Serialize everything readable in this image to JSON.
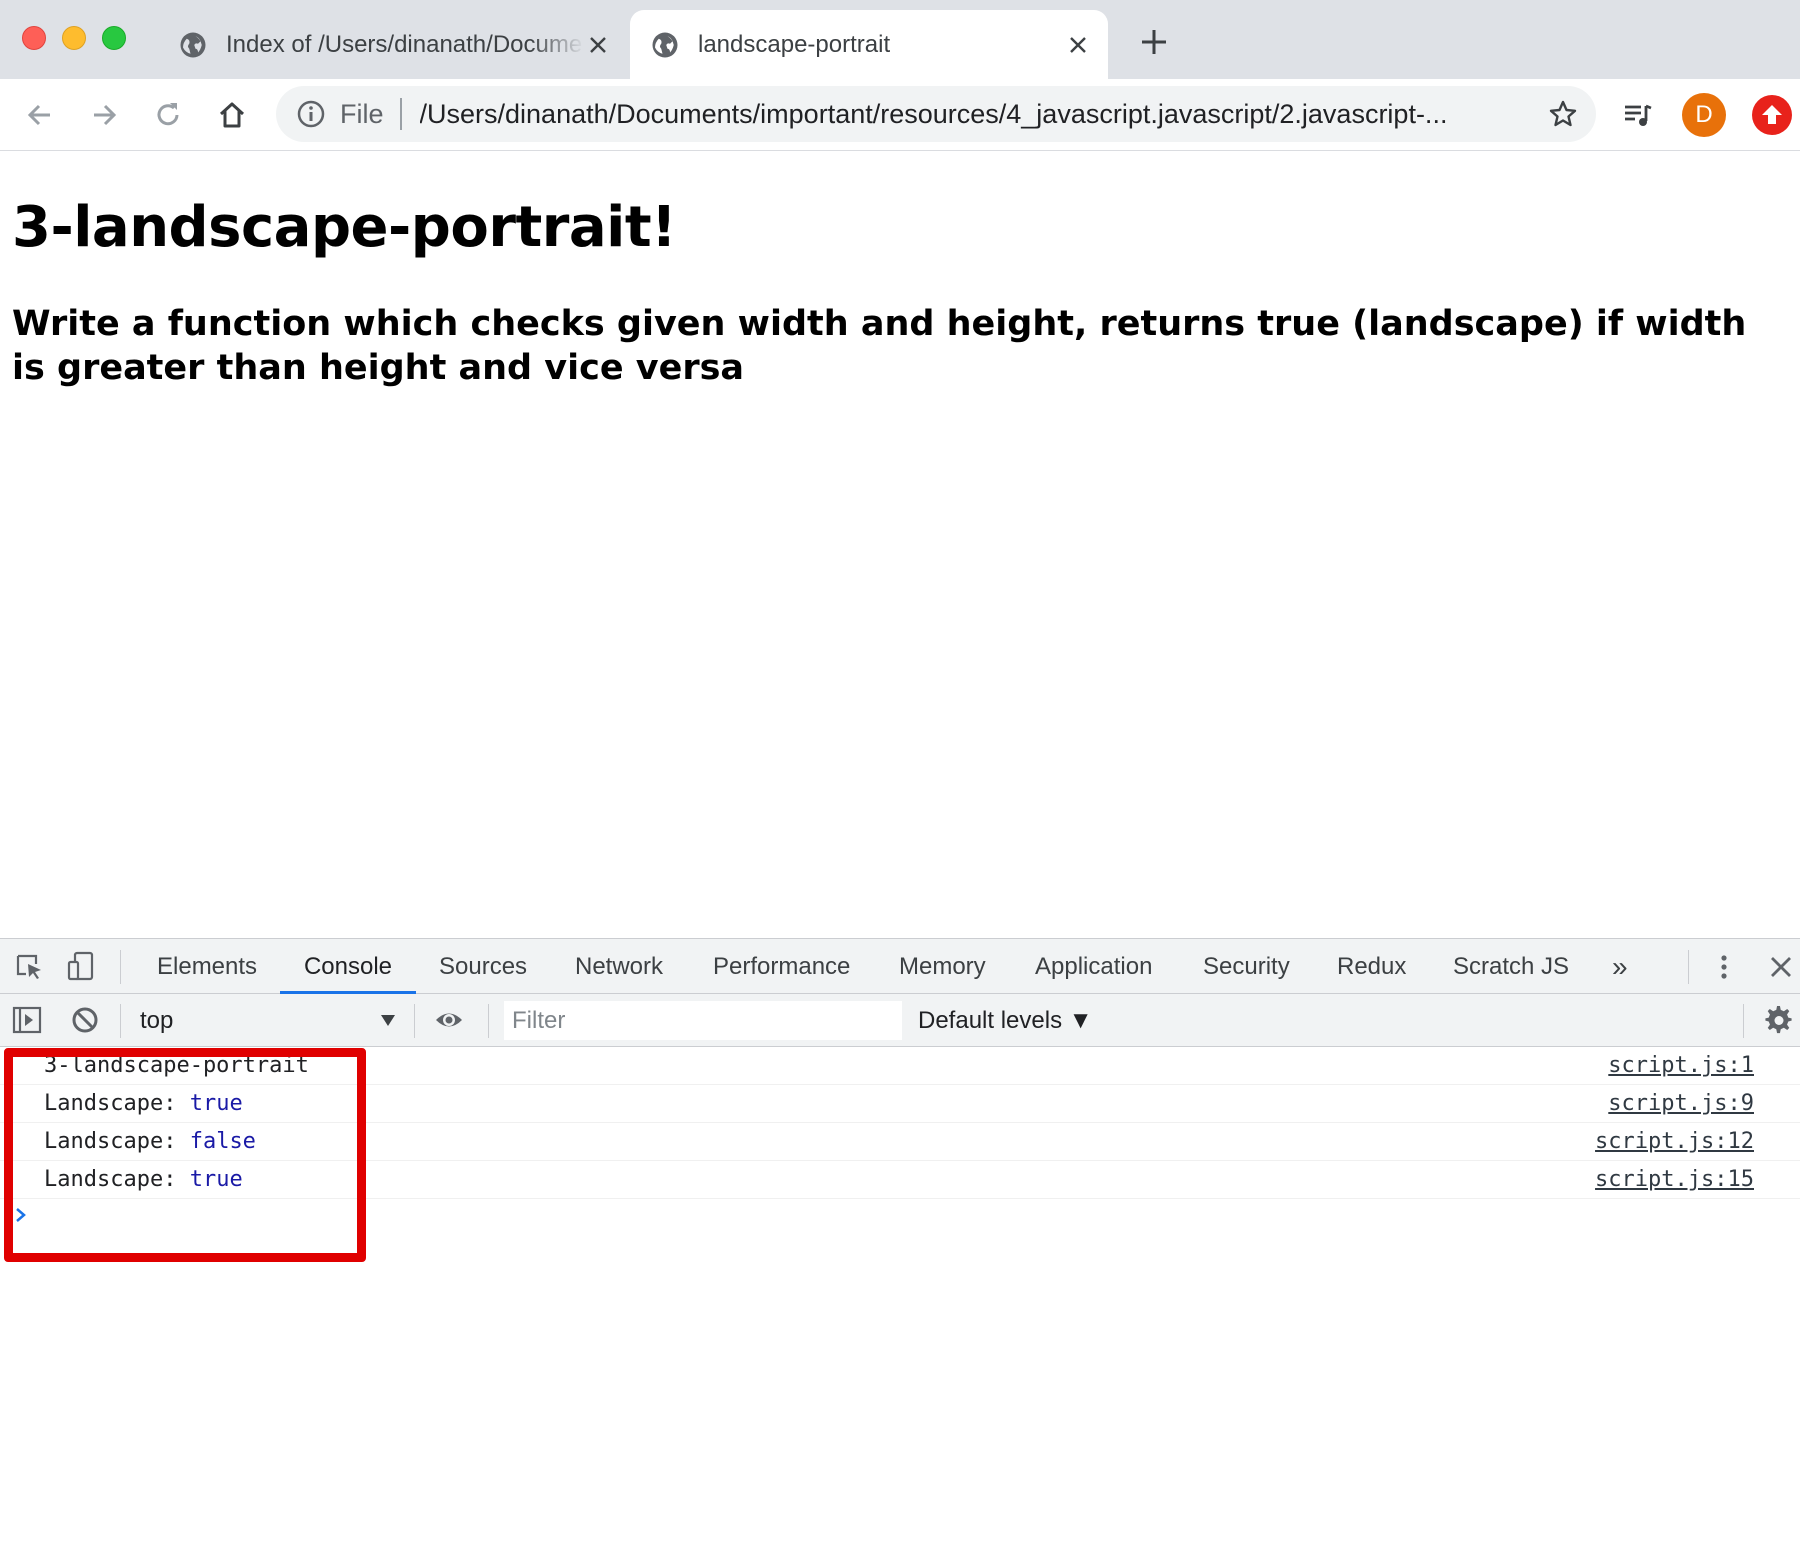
{
  "browser": {
    "tabs": [
      {
        "title": "Index of /Users/dinanath/Documents",
        "active": false
      },
      {
        "title": "landscape-portrait",
        "active": true
      }
    ],
    "omnibox": {
      "scheme": "File",
      "url": "/Users/dinanath/Documents/important/resources/4_javascript.javascript/2.javascript-..."
    },
    "profile_initial": "D",
    "colors": {
      "profile": "#e8710a",
      "extension": "#e8221b",
      "accent": "#1a73e8",
      "highlight": "#e00000"
    }
  },
  "page": {
    "heading": "3-landscape-portrait!",
    "subheading": "Write a function which checks given width and height, returns true (landscape) if width is greater than height and vice versa"
  },
  "devtools": {
    "tabs": [
      "Elements",
      "Console",
      "Sources",
      "Network",
      "Performance",
      "Memory",
      "Application",
      "Security",
      "Redux",
      "Scratch JS"
    ],
    "active_tab": "Console",
    "overflow": "»",
    "context": "top",
    "filter_placeholder": "Filter",
    "levels": "Default levels ▼",
    "console": [
      {
        "text": "3-landscape-portrait",
        "value": "",
        "source": "script.js:1"
      },
      {
        "text": "Landscape: ",
        "value": "true",
        "source": "script.js:9"
      },
      {
        "text": "Landscape: ",
        "value": "false",
        "source": "script.js:12"
      },
      {
        "text": "Landscape: ",
        "value": "true",
        "source": "script.js:15"
      }
    ]
  }
}
